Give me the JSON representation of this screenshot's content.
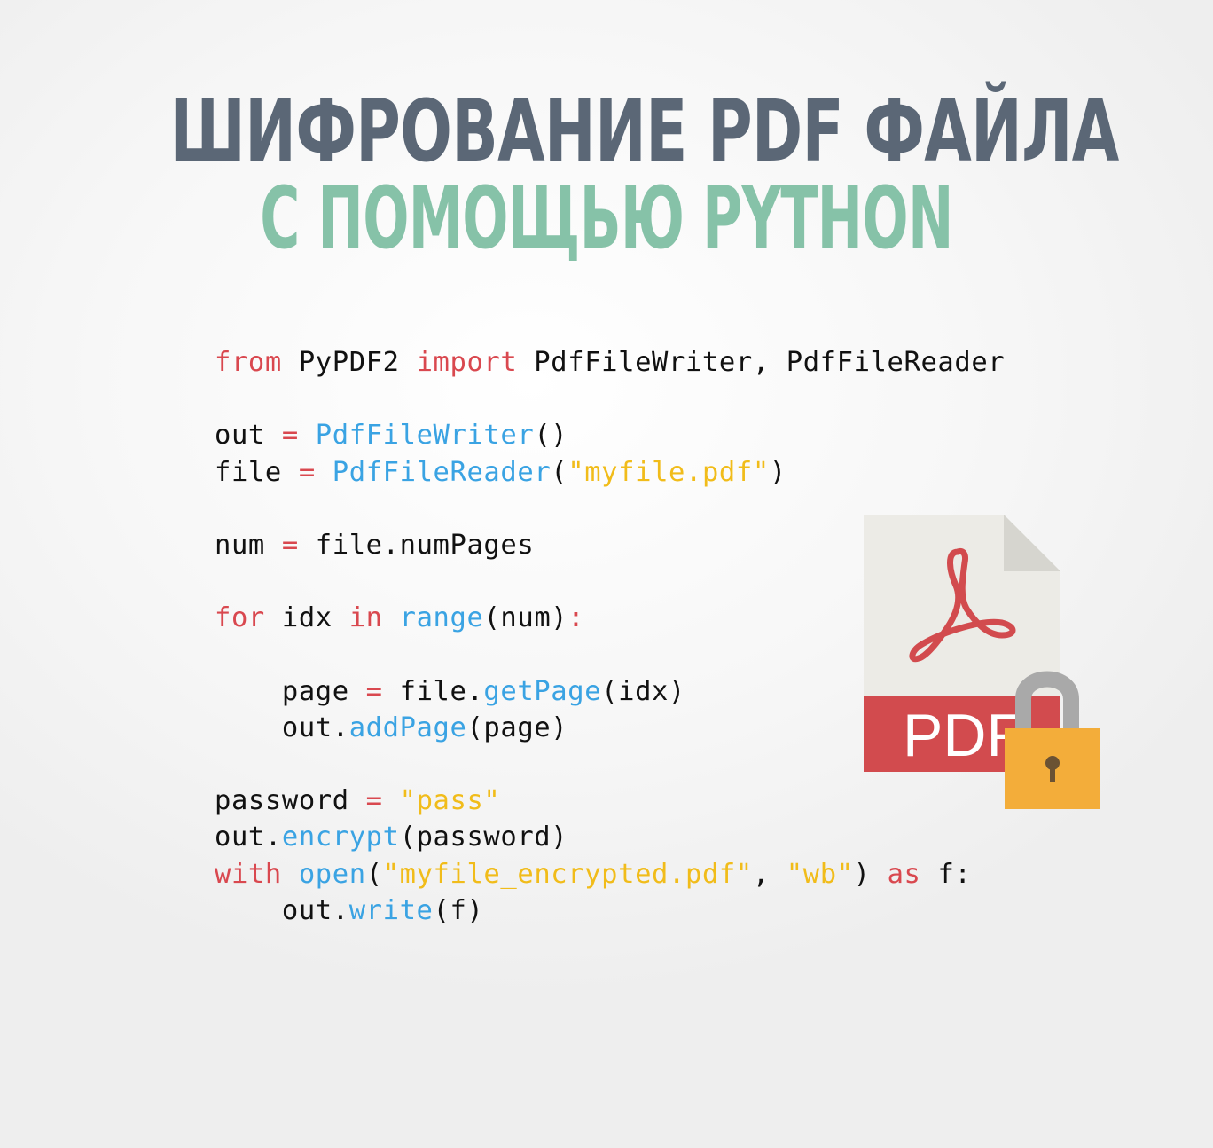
{
  "title": {
    "line1": "ШИФРОВАНИЕ PDF ФАЙЛА",
    "line2": "С ПОМОЩЬЮ PYTHON"
  },
  "code": {
    "lines": [
      [
        {
          "t": "kw",
          "v": "from"
        },
        {
          "t": "txt",
          "v": " PyPDF2 "
        },
        {
          "t": "kw",
          "v": "import"
        },
        {
          "t": "txt",
          "v": " PdfFileWriter, PdfFileReader"
        }
      ],
      [],
      [
        {
          "t": "txt",
          "v": "out "
        },
        {
          "t": "op",
          "v": "="
        },
        {
          "t": "txt",
          "v": " "
        },
        {
          "t": "fn",
          "v": "PdfFileWriter"
        },
        {
          "t": "txt",
          "v": "()"
        }
      ],
      [
        {
          "t": "txt",
          "v": "file "
        },
        {
          "t": "op",
          "v": "="
        },
        {
          "t": "txt",
          "v": " "
        },
        {
          "t": "fn",
          "v": "PdfFileReader"
        },
        {
          "t": "txt",
          "v": "("
        },
        {
          "t": "str",
          "v": "\"myfile.pdf\""
        },
        {
          "t": "txt",
          "v": ")"
        }
      ],
      [],
      [
        {
          "t": "txt",
          "v": "num "
        },
        {
          "t": "op",
          "v": "="
        },
        {
          "t": "txt",
          "v": " file.numPages"
        }
      ],
      [],
      [
        {
          "t": "kw",
          "v": "for"
        },
        {
          "t": "txt",
          "v": " idx "
        },
        {
          "t": "kw",
          "v": "in"
        },
        {
          "t": "txt",
          "v": " "
        },
        {
          "t": "fn",
          "v": "range"
        },
        {
          "t": "txt",
          "v": "(num)"
        },
        {
          "t": "op",
          "v": ":"
        }
      ],
      [],
      [
        {
          "t": "txt",
          "v": "    page "
        },
        {
          "t": "op",
          "v": "="
        },
        {
          "t": "txt",
          "v": " file."
        },
        {
          "t": "fn",
          "v": "getPage"
        },
        {
          "t": "txt",
          "v": "(idx)"
        }
      ],
      [
        {
          "t": "txt",
          "v": "    out."
        },
        {
          "t": "fn",
          "v": "addPage"
        },
        {
          "t": "txt",
          "v": "(page)"
        }
      ],
      [],
      [
        {
          "t": "txt",
          "v": "password "
        },
        {
          "t": "op",
          "v": "="
        },
        {
          "t": "txt",
          "v": " "
        },
        {
          "t": "str",
          "v": "\"pass\""
        }
      ],
      [
        {
          "t": "txt",
          "v": "out."
        },
        {
          "t": "fn",
          "v": "encrypt"
        },
        {
          "t": "txt",
          "v": "(password)"
        }
      ],
      [
        {
          "t": "kw",
          "v": "with"
        },
        {
          "t": "txt",
          "v": " "
        },
        {
          "t": "fn",
          "v": "open"
        },
        {
          "t": "txt",
          "v": "("
        },
        {
          "t": "str",
          "v": "\"myfile_encrypted.pdf\""
        },
        {
          "t": "txt",
          "v": ", "
        },
        {
          "t": "str",
          "v": "\"wb\""
        },
        {
          "t": "txt",
          "v": ") "
        },
        {
          "t": "kw",
          "v": "as"
        },
        {
          "t": "txt",
          "v": " f:"
        }
      ],
      [
        {
          "t": "txt",
          "v": "    out."
        },
        {
          "t": "fn",
          "v": "write"
        },
        {
          "t": "txt",
          "v": "(f)"
        }
      ]
    ]
  },
  "illustration": {
    "label": "PDF",
    "icon": "pdf-file-locked-icon",
    "colors": {
      "page": "#ecebe6",
      "fold": "#d6d5cf",
      "band": "#d24b4e",
      "acrobat": "#d24b4e",
      "shackle": "#a9a9a9",
      "lock_body": "#f3ad3a",
      "keyhole": "#6b5233"
    }
  },
  "colors": {
    "title_primary": "#5b6776",
    "title_accent": "#86c2a8",
    "keyword": "#d9484f",
    "function": "#3aa3e3",
    "string": "#f1bc1a",
    "text": "#111111"
  }
}
